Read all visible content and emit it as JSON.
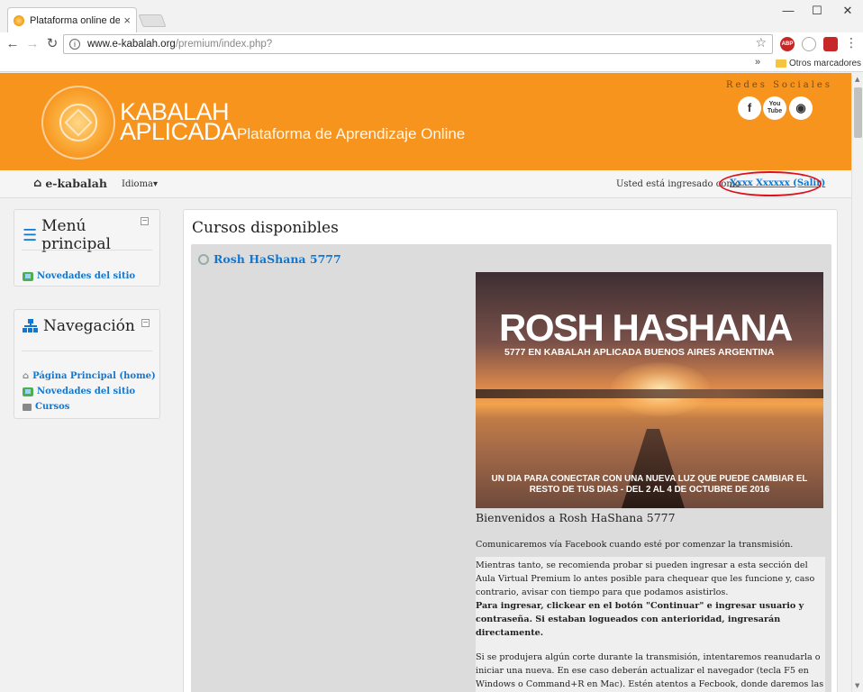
{
  "browser": {
    "tab_title": "Plataforma online de ens",
    "tab_close": "×",
    "url_domain": "www.e-kabalah.org",
    "url_path": "/premium/index.php?",
    "bookmarks_chevron": "»",
    "bookmarks_folder": "Otros marcadores",
    "window_controls": {
      "minimize": "—",
      "maximize": "☐",
      "close": "✕"
    },
    "ext_abp": "ABP"
  },
  "header": {
    "brand_line1": "KABALAH",
    "brand_line2": "APLICADA",
    "tagline": "Plataforma de Aprendizaje Online",
    "social_title": "Redes Sociales",
    "social": {
      "facebook": "f",
      "youtube": "You Tube",
      "web": "◉"
    }
  },
  "navbar": {
    "home": "e-kabalah",
    "language": "Idioma",
    "logged_in_text": "Usted está ingresado como",
    "user_link": "Xxxx Xxxxxx (Salir)"
  },
  "sidebar": {
    "main_menu": {
      "title": "Menú principal",
      "items": [
        "Novedades del sitio"
      ]
    },
    "navigation": {
      "title": "Navegación",
      "items": [
        "Página Principal (home)",
        "Novedades del sitio",
        "Cursos"
      ]
    }
  },
  "content": {
    "title": "Cursos disponibles",
    "course": {
      "name": "Rosh HaShana 5777",
      "banner": {
        "title": "ROSH HASHANA",
        "subtitle": "5777 EN KABALAH APLICADA BUENOS AIRES ARGENTINA",
        "footer": "UN DIA PARA CONECTAR CON UNA NUEVA LUZ QUE PUEDE CAMBIAR EL RESTO DE TUS DIAS - DEL 2 AL 4 DE OCTUBRE DE 2016"
      },
      "welcome": "Bienvenidos a Rosh HaShana 5777",
      "p1": "Comunicaremos vía Facebook cuando esté por comenzar la transmisión.",
      "p2": "Mientras tanto, se recomienda probar si pueden ingresar a esta sección del Aula Virtual Premium lo antes posible para chequear que les funcione y, caso contrario, avisar con tiempo para que podamos asistirlos.",
      "p2_bold": "Para ingresar, clickear en el botón \"Continuar\" e ingresar usuario y contraseña. Si estaban logueados con anterioridad, ingresarán directamente.",
      "p3": "Si se produjera algún corte durante la transmisión, intentaremos reanudarla o iniciar una nueva. En ese caso deberán actualizar el navegador (tecla F5 en Windows o Command+R en Mac). Estén atentos a Fecbook, donde daremos las instrucciones necesarias."
    }
  },
  "colors": {
    "header_orange": "#f7941d",
    "link_blue": "#1177d1",
    "highlight_red": "#e0101a"
  }
}
